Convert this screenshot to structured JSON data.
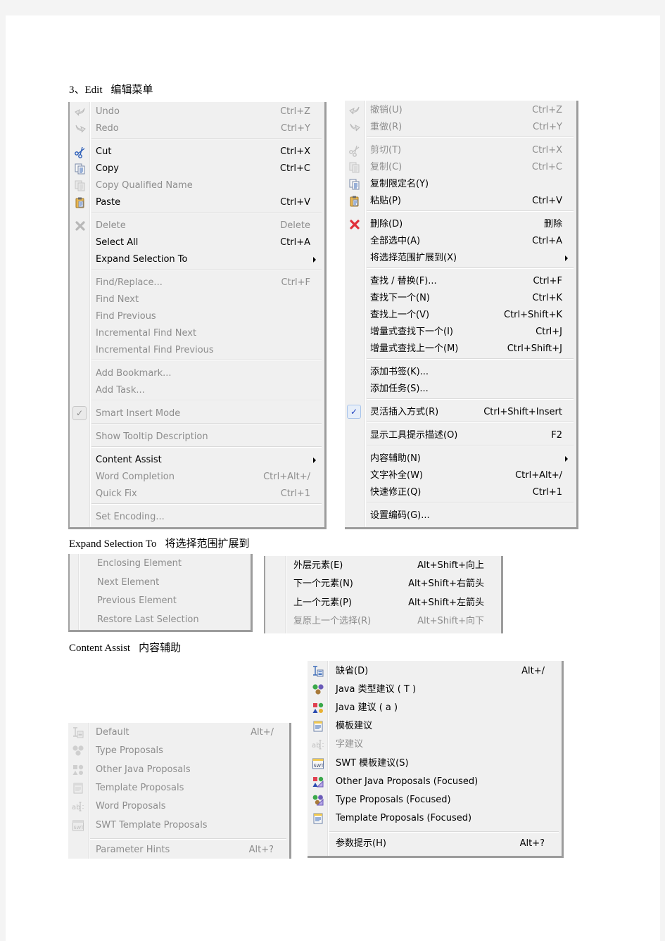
{
  "headings": {
    "edit": {
      "en": "3、Edit",
      "cn": "编辑菜单"
    },
    "expand": {
      "en": "Expand  Selection  To",
      "cn": "将选择范围扩展到"
    },
    "assist": {
      "en": "Content  Assist",
      "cn": "内容辅助"
    }
  },
  "edit_menu_en": {
    "items": [
      {
        "label": "Undo",
        "shortcut": "Ctrl+Z",
        "icon": "undo-icon",
        "enabled": false
      },
      {
        "label": "Redo",
        "shortcut": "Ctrl+Y",
        "icon": "redo-icon",
        "enabled": false
      },
      {
        "label": "Cut",
        "shortcut": "Ctrl+X",
        "icon": "cut-icon",
        "enabled": true
      },
      {
        "label": "Copy",
        "shortcut": "Ctrl+C",
        "icon": "copy-icon",
        "enabled": true
      },
      {
        "label": "Copy Qualified Name",
        "shortcut": "",
        "icon": "copy-qualified-name-icon",
        "enabled": false
      },
      {
        "label": "Paste",
        "shortcut": "Ctrl+V",
        "icon": "paste-icon",
        "enabled": true
      },
      {
        "label": "Delete",
        "shortcut": "Delete",
        "icon": "delete-icon",
        "enabled": false
      },
      {
        "label": "Select All",
        "shortcut": "Ctrl+A",
        "icon": "",
        "enabled": true
      },
      {
        "label": "Expand Selection To",
        "shortcut": "",
        "icon": "",
        "enabled": true,
        "submenu": true
      },
      {
        "label": "Find/Replace...",
        "shortcut": "Ctrl+F",
        "icon": "",
        "enabled": false
      },
      {
        "label": "Find Next",
        "shortcut": "",
        "icon": "",
        "enabled": false
      },
      {
        "label": "Find Previous",
        "shortcut": "",
        "icon": "",
        "enabled": false
      },
      {
        "label": "Incremental Find Next",
        "shortcut": "",
        "icon": "",
        "enabled": false
      },
      {
        "label": "Incremental Find Previous",
        "shortcut": "",
        "icon": "",
        "enabled": false
      },
      {
        "label": "Add Bookmark...",
        "shortcut": "",
        "icon": "",
        "enabled": false
      },
      {
        "label": "Add Task...",
        "shortcut": "",
        "icon": "",
        "enabled": false
      },
      {
        "label": "Smart Insert Mode",
        "shortcut": "",
        "icon": "check-icon",
        "enabled": false,
        "checked": true
      },
      {
        "label": "Show Tooltip Description",
        "shortcut": "",
        "icon": "",
        "enabled": false
      },
      {
        "label": "Content Assist",
        "shortcut": "",
        "icon": "",
        "enabled": true,
        "submenu": true
      },
      {
        "label": "Word Completion",
        "shortcut": "Ctrl+Alt+/",
        "icon": "",
        "enabled": false
      },
      {
        "label": "Quick Fix",
        "shortcut": "Ctrl+1",
        "icon": "",
        "enabled": false
      },
      {
        "label": "Set Encoding...",
        "shortcut": "",
        "icon": "",
        "enabled": false
      }
    ]
  },
  "edit_menu_cn": {
    "items": [
      {
        "label": "撤销(U)",
        "shortcut": "Ctrl+Z",
        "icon": "undo-icon",
        "enabled": false
      },
      {
        "label": "重做(R)",
        "shortcut": "Ctrl+Y",
        "icon": "redo-icon",
        "enabled": false
      },
      {
        "label": "剪切(T)",
        "shortcut": "Ctrl+X",
        "icon": "cut-icon",
        "enabled": false
      },
      {
        "label": "复制(C)",
        "shortcut": "Ctrl+C",
        "icon": "copy-icon",
        "enabled": false
      },
      {
        "label": "复制限定名(Y)",
        "shortcut": "",
        "icon": "copy-qualified-name-icon",
        "enabled": true
      },
      {
        "label": "粘贴(P)",
        "shortcut": "Ctrl+V",
        "icon": "paste-icon",
        "enabled": true
      },
      {
        "label": "删除(D)",
        "shortcut": "删除",
        "icon": "delete-icon",
        "enabled": true
      },
      {
        "label": "全部选中(A)",
        "shortcut": "Ctrl+A",
        "icon": "",
        "enabled": true
      },
      {
        "label": "将选择范围扩展到(X)",
        "shortcut": "",
        "icon": "",
        "enabled": true,
        "submenu": true
      },
      {
        "label": "查找 / 替换(F)...",
        "shortcut": "Ctrl+F",
        "icon": "",
        "enabled": true
      },
      {
        "label": "查找下一个(N)",
        "shortcut": "Ctrl+K",
        "icon": "",
        "enabled": true
      },
      {
        "label": "查找上一个(V)",
        "shortcut": "Ctrl+Shift+K",
        "icon": "",
        "enabled": true
      },
      {
        "label": "增量式查找下一个(I)",
        "shortcut": "Ctrl+J",
        "icon": "",
        "enabled": true
      },
      {
        "label": "增量式查找上一个(M)",
        "shortcut": "Ctrl+Shift+J",
        "icon": "",
        "enabled": true
      },
      {
        "label": "添加书签(K)...",
        "shortcut": "",
        "icon": "",
        "enabled": true
      },
      {
        "label": "添加任务(S)...",
        "shortcut": "",
        "icon": "",
        "enabled": true
      },
      {
        "label": "灵活插入方式(R)",
        "shortcut": "Ctrl+Shift+Insert",
        "icon": "check-icon",
        "enabled": true,
        "checked": true
      },
      {
        "label": "显示工具提示描述(O)",
        "shortcut": "F2",
        "icon": "",
        "enabled": true
      },
      {
        "label": "内容辅助(N)",
        "shortcut": "",
        "icon": "",
        "enabled": true,
        "submenu": true
      },
      {
        "label": "文字补全(W)",
        "shortcut": "Ctrl+Alt+/",
        "icon": "",
        "enabled": true
      },
      {
        "label": "快速修正(Q)",
        "shortcut": "Ctrl+1",
        "icon": "",
        "enabled": true
      },
      {
        "label": "设置编码(G)...",
        "shortcut": "",
        "icon": "",
        "enabled": true
      }
    ]
  },
  "expand_menu_en": {
    "items": [
      {
        "label": "Enclosing Element",
        "shortcut": "",
        "enabled": false
      },
      {
        "label": "Next Element",
        "shortcut": "",
        "enabled": false
      },
      {
        "label": "Previous Element",
        "shortcut": "",
        "enabled": false
      },
      {
        "label": "Restore Last Selection",
        "shortcut": "",
        "enabled": false
      }
    ]
  },
  "expand_menu_cn": {
    "items": [
      {
        "label": "外层元素(E)",
        "shortcut": "Alt+Shift+向上",
        "enabled": true
      },
      {
        "label": "下一个元素(N)",
        "shortcut": "Alt+Shift+右箭头",
        "enabled": true
      },
      {
        "label": "上一个元素(P)",
        "shortcut": "Alt+Shift+左箭头",
        "enabled": true
      },
      {
        "label": "复原上一个选择(R)",
        "shortcut": "Alt+Shift+向下",
        "enabled": false
      }
    ]
  },
  "assist_menu_en": {
    "items": [
      {
        "label": "Default",
        "shortcut": "Alt+/",
        "icon": "default-proposals-icon",
        "enabled": false
      },
      {
        "label": "Type Proposals",
        "shortcut": "",
        "icon": "type-proposals-icon",
        "enabled": false
      },
      {
        "label": "Other Java Proposals",
        "shortcut": "",
        "icon": "java-proposals-icon",
        "enabled": false
      },
      {
        "label": "Template Proposals",
        "shortcut": "",
        "icon": "template-proposals-icon",
        "enabled": false
      },
      {
        "label": "Word Proposals",
        "shortcut": "",
        "icon": "word-proposals-icon",
        "enabled": false
      },
      {
        "label": "SWT Template Proposals",
        "shortcut": "",
        "icon": "swt-template-icon",
        "enabled": false
      },
      {
        "label": "Parameter Hints",
        "shortcut": "Alt+?",
        "icon": "",
        "enabled": false
      }
    ]
  },
  "assist_menu_cn": {
    "items": [
      {
        "label": "缺省(D)",
        "shortcut": "Alt+/",
        "icon": "default-proposals-icon",
        "enabled": true
      },
      {
        "label": "Java 类型建议 ( T )",
        "shortcut": "",
        "icon": "type-proposals-icon",
        "enabled": true
      },
      {
        "label": "Java 建议 ( a )",
        "shortcut": "",
        "icon": "java-proposals-icon",
        "enabled": true
      },
      {
        "label": "模板建议",
        "shortcut": "",
        "icon": "template-proposals-icon",
        "enabled": true
      },
      {
        "label": "字建议",
        "shortcut": "",
        "icon": "word-proposals-icon",
        "enabled": false
      },
      {
        "label": "SWT 模板建议(S)",
        "shortcut": "",
        "icon": "swt-template-icon",
        "enabled": true
      },
      {
        "label": "Other Java Proposals (Focused)",
        "shortcut": "",
        "icon": "java-proposals-focused-icon",
        "enabled": true
      },
      {
        "label": "Type Proposals (Focused)",
        "shortcut": "",
        "icon": "type-proposals-focused-icon",
        "enabled": true
      },
      {
        "label": "Template Proposals (Focused)",
        "shortcut": "",
        "icon": "template-proposals-focused-icon",
        "enabled": true
      },
      {
        "label": "参数提示(H)",
        "shortcut": "Alt+?",
        "icon": "",
        "enabled": true
      }
    ]
  },
  "colors": {
    "menu_bg": "#f0f0f0",
    "disabled_text": "#8d8d8d",
    "enabled_text": "#000000",
    "delete_red": "#e0303a",
    "check_blue": "#1f3fbf"
  }
}
